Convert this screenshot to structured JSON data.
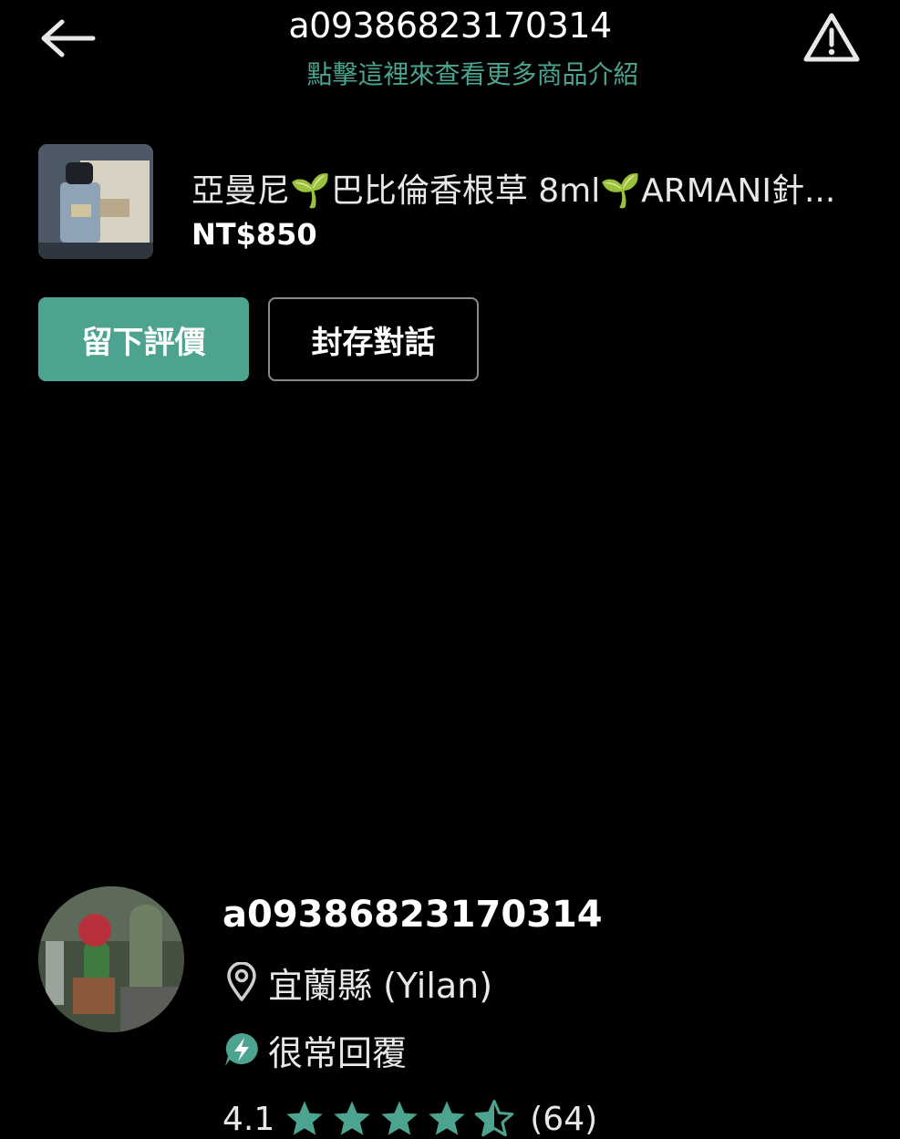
{
  "header": {
    "title": "a09386823170314",
    "subtitle": "點擊這裡來查看更多商品介紹",
    "back_icon": "arrow-left-icon",
    "report_icon": "warning-triangle-icon"
  },
  "product": {
    "title": "亞曼尼🌱巴比倫香根草 8ml🌱ARMANI針...",
    "price": "NT$850"
  },
  "actions": {
    "review_label": "留下評價",
    "archive_label": "封存對話"
  },
  "seller": {
    "name": "a09386823170314",
    "location": "宜蘭縣 (Yilan)",
    "response": "很常回覆",
    "rating_value": "4.1",
    "rating_stars": 4.5,
    "rating_count": "(64)"
  },
  "colors": {
    "accent": "#4ca38f",
    "background": "#000000",
    "text": "#ffffff"
  }
}
